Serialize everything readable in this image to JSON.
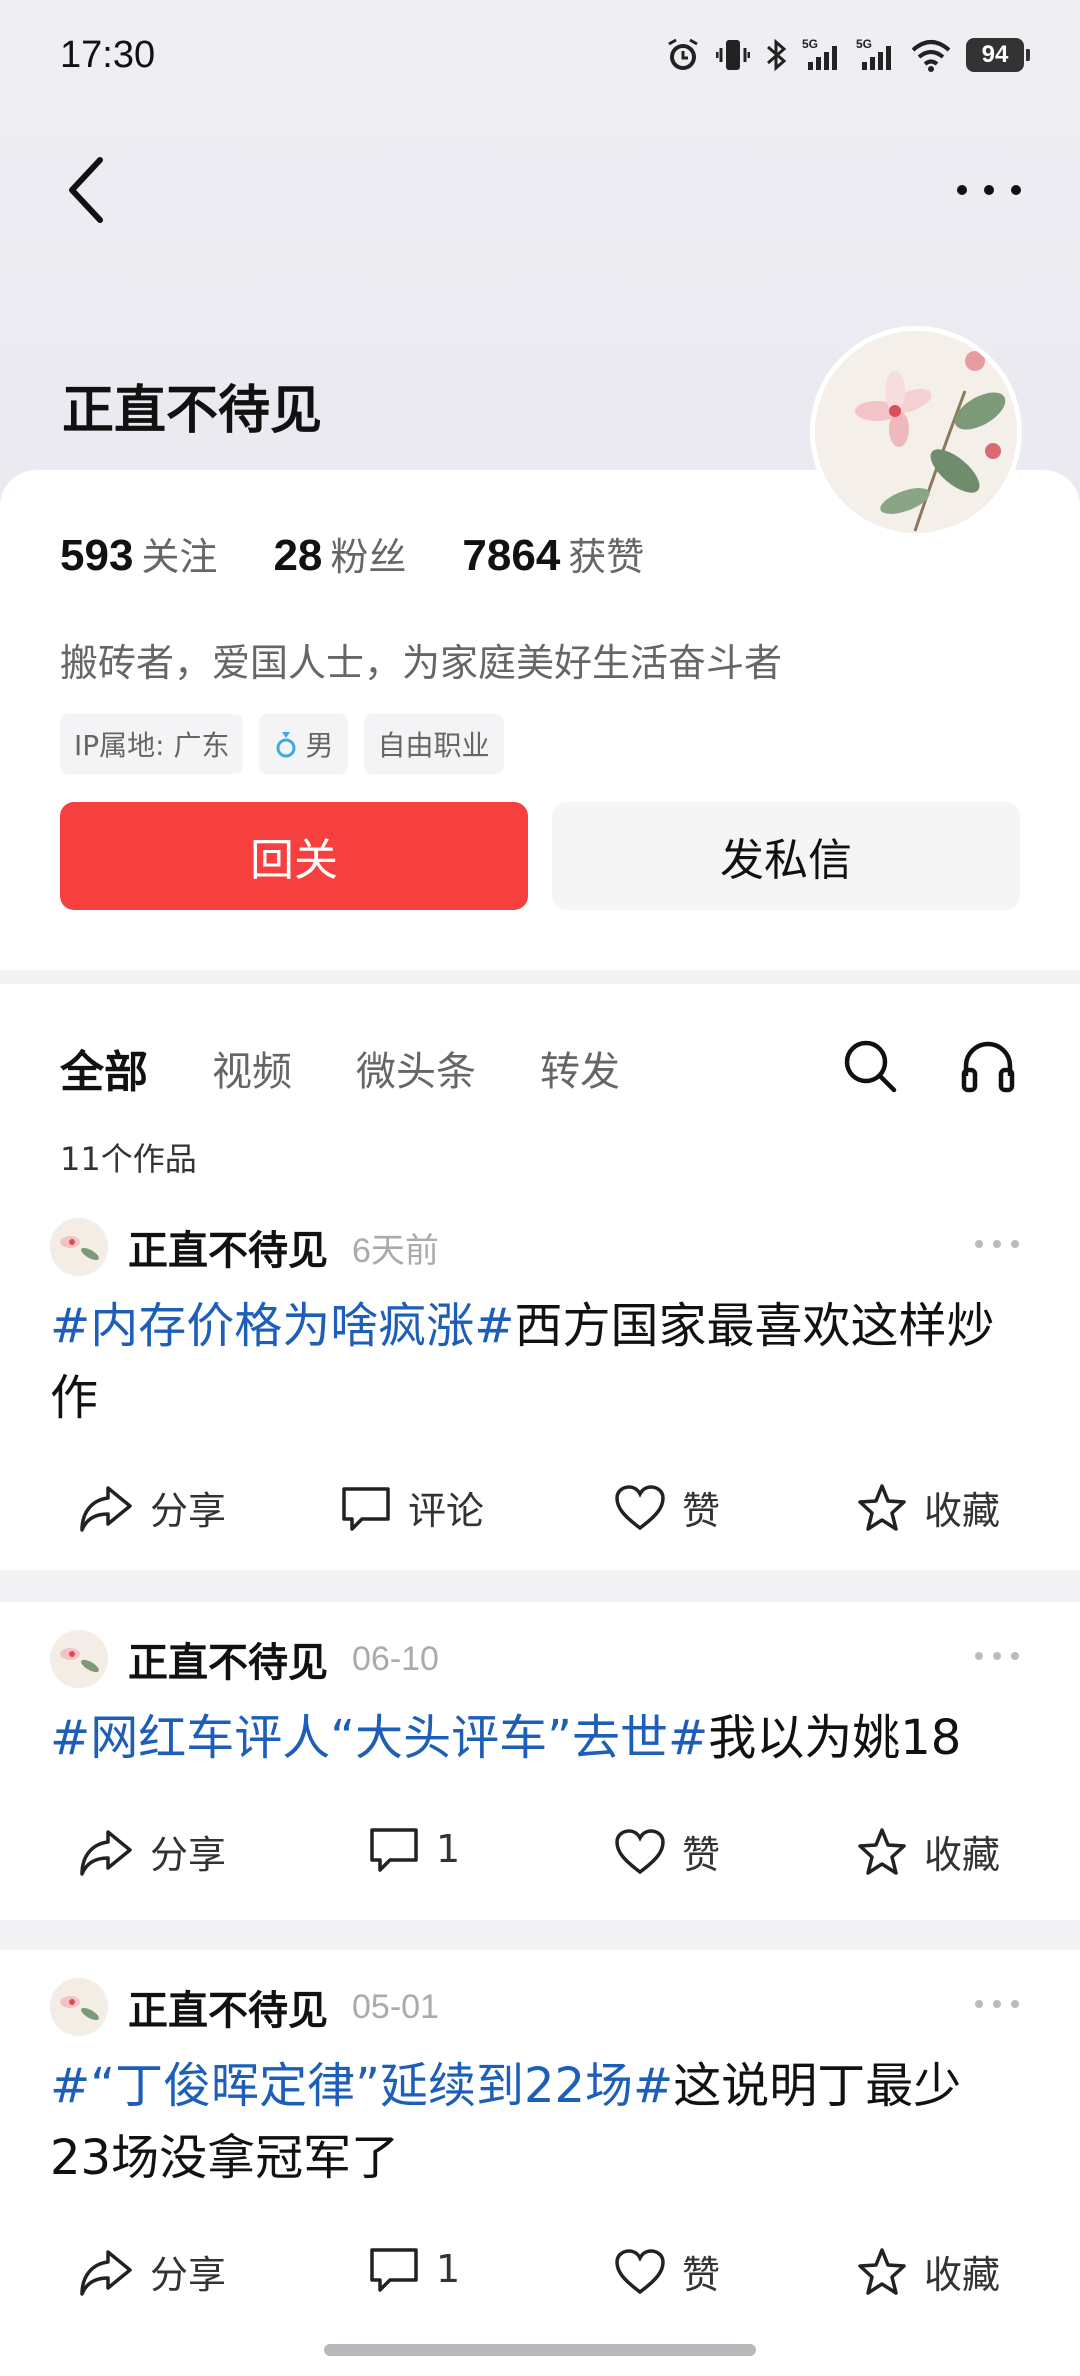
{
  "status_bar": {
    "time": "17:30",
    "battery": "94",
    "signal_1": "5G",
    "signal_2": "5G"
  },
  "profile": {
    "name": "正直不待见",
    "stats": [
      {
        "num": "593",
        "label": "关注"
      },
      {
        "num": "28",
        "label": "粉丝"
      },
      {
        "num": "7864",
        "label": "获赞"
      }
    ],
    "bio": "搬砖者，爱国人士，为家庭美好生活奋斗者",
    "tags": [
      "IP属地: 广东",
      "男",
      "自由职业"
    ],
    "follow_label": "回关",
    "message_label": "发私信"
  },
  "tabs": [
    "全部",
    "视频",
    "微头条",
    "转发"
  ],
  "works_count": "11个作品",
  "posts": [
    {
      "author": "正直不待见",
      "time": "6天前",
      "hashtag": "#内存价格为啥疯涨#",
      "text": "西方国家最喜欢这样炒作",
      "share": "分享",
      "comment": "评论",
      "like": "赞",
      "collect": "收藏"
    },
    {
      "author": "正直不待见",
      "time": "06-10",
      "hashtag": "#网红车评人“大头评车”去世#",
      "text": "我以为姚18",
      "share": "分享",
      "comment": "1",
      "like": "赞",
      "collect": "收藏"
    },
    {
      "author": "正直不待见",
      "time": "05-01",
      "hashtag": "#“丁俊晖定律”延续到22场#",
      "text": "这说明丁最少23场没拿冠军了",
      "share": "分享",
      "comment": "1",
      "like": "赞",
      "collect": "收藏"
    }
  ],
  "colors": {
    "accent_red": "#f6403f",
    "hashtag_blue": "#1d5fb8"
  }
}
